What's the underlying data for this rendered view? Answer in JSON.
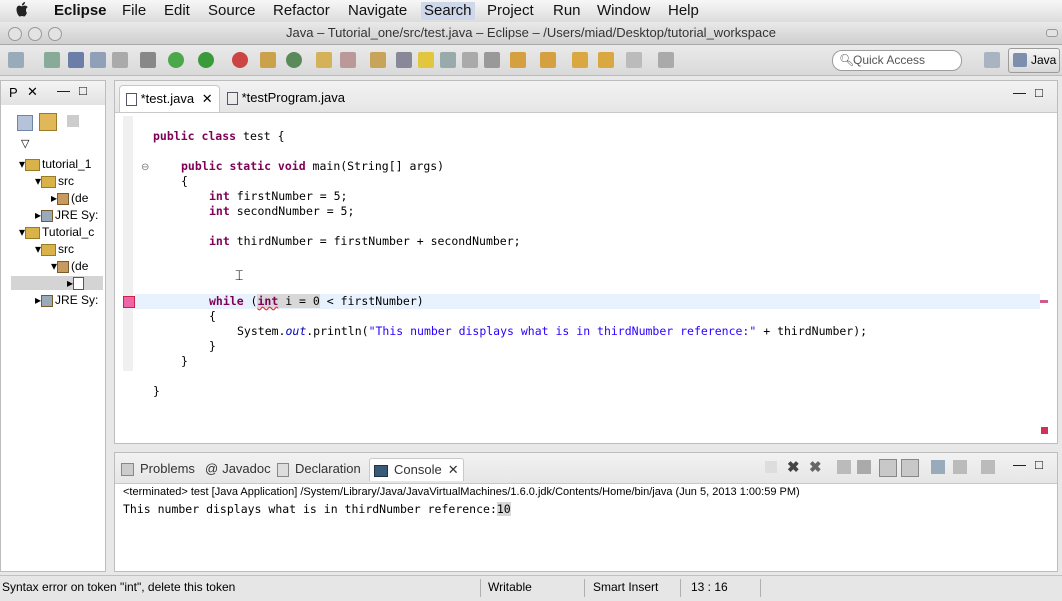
{
  "menubar": {
    "app": "Eclipse",
    "items": [
      "File",
      "Edit",
      "Source",
      "Refactor",
      "Navigate",
      "Search",
      "Project",
      "Run",
      "Window",
      "Help"
    ]
  },
  "window": {
    "title": "Java – Tutorial_one/src/test.java – Eclipse – /Users/miad/Desktop/tutorial_workspace"
  },
  "toolbar": {
    "quick_access_placeholder": "Quick Access",
    "perspective": "Java"
  },
  "explorer": {
    "tab_label": "P",
    "tree": [
      {
        "label": "tutorial_1"
      },
      {
        "label": "src"
      },
      {
        "label": "(de"
      },
      {
        "label": "JRE Sy:"
      },
      {
        "label": "Tutorial_c"
      },
      {
        "label": "src"
      },
      {
        "label": "(de"
      },
      {
        "label": ""
      },
      {
        "label": "JRE Sy:"
      }
    ]
  },
  "editor": {
    "tabs": [
      {
        "label": "*test.java"
      },
      {
        "label": "*testProgram.java"
      }
    ],
    "code": {
      "l1_kw": "public class",
      "l1_rest": " test {",
      "l2_kw": "public static void",
      "l2_rest": " main(String[] args)",
      "l3": "{",
      "l4_kw": "int",
      "l4_rest": " firstNumber = 5;",
      "l5_kw": "int",
      "l5_rest": " secondNumber = 5;",
      "l6_kw": "int",
      "l6_rest": " thirdNumber = firstNumber + secondNumber;",
      "l7_kw": "while",
      "l7_open": " (",
      "l7_err": "int",
      "l7_mid": " i = 0",
      "l7_rest": " < firstNumber)",
      "l8": "{",
      "l9_a": "System.",
      "l9_b": "out",
      "l9_c": ".println(",
      "l9_str": "\"This number displays what is in thirdNumber reference:\"",
      "l9_d": " + thirdNumber);",
      "l10": "}",
      "l11": "}",
      "l12": "}"
    }
  },
  "console": {
    "tabs": [
      {
        "label": "Problems"
      },
      {
        "label": "Javadoc"
      },
      {
        "label": "Declaration"
      },
      {
        "label": "Console"
      }
    ],
    "terminated": "<terminated> test [Java Application] /System/Library/Java/JavaVirtualMachines/1.6.0.jdk/Contents/Home/bin/java (Jun 5, 2013 1:00:59 PM)",
    "output_text": "This number displays what is in thirdNumber reference:",
    "output_value": "10"
  },
  "status": {
    "message": "Syntax error on token \"int\", delete this token",
    "writable": "Writable",
    "insert_mode": "Smart Insert",
    "position": "13 : 16"
  },
  "colors": {
    "keyword": "#7f0055",
    "string": "#2a00ff",
    "field": "#0000c0",
    "error_marker": "#d0305a"
  }
}
